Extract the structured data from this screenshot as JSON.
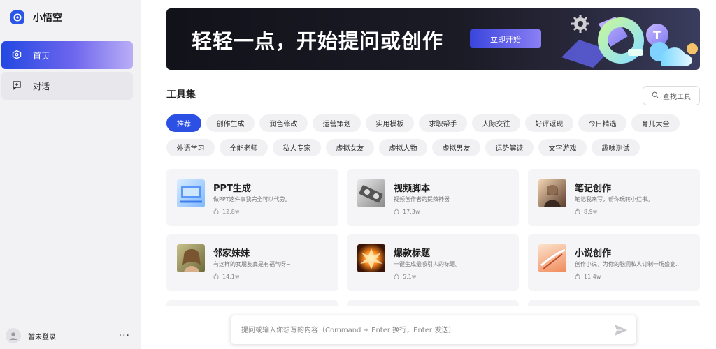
{
  "app": {
    "name": "小悟空"
  },
  "nav": {
    "items": [
      {
        "label": "首页"
      },
      {
        "label": "对话"
      }
    ]
  },
  "user": {
    "name": "暂未登录",
    "more": "···"
  },
  "banner": {
    "title": "轻轻一点，开始提问或创作",
    "button": "立即开始"
  },
  "tools": {
    "title": "工具集",
    "search_label": "查找工具",
    "categories_row1": [
      "推荐",
      "创作生成",
      "润色修改",
      "运营策划",
      "实用模板",
      "求职帮手",
      "人际交往",
      "好评返现",
      "今日精选",
      "育儿大全"
    ],
    "categories_row2": [
      "外语学习",
      "全能老师",
      "私人专家",
      "虚拟女友",
      "虚拟人物",
      "虚拟男友",
      "运势解读",
      "文字游戏",
      "趣味测试"
    ],
    "active_category": "推荐",
    "cards": [
      {
        "title": "PPT生成",
        "desc": "做PPT这件事我完全可以代劳。",
        "count": "12.8w"
      },
      {
        "title": "视频脚本",
        "desc": "视频创作者的提效神器",
        "count": "17.3w"
      },
      {
        "title": "笔记创作",
        "desc": "笔记我来写，帮你玩转小红书。",
        "count": "8.9w"
      },
      {
        "title": "邻家妹妹",
        "desc": "有这样的女朋友真是有福气呀~",
        "count": "14.1w"
      },
      {
        "title": "爆款标题",
        "desc": "一键生成最吸引人的标题。",
        "count": "5.1w"
      },
      {
        "title": "小说创作",
        "desc": "创作小说，为你的脑洞私人订制一场盛宴...",
        "count": "11.4w"
      }
    ]
  },
  "prompt": {
    "placeholder": "提问或输入你想写的内容（Command + Enter 换行，Enter 发送）"
  },
  "colors": {
    "accent": "#2c4fe4",
    "sidebar_bg": "#f2f2f4",
    "card_bg": "#f5f5f7"
  }
}
